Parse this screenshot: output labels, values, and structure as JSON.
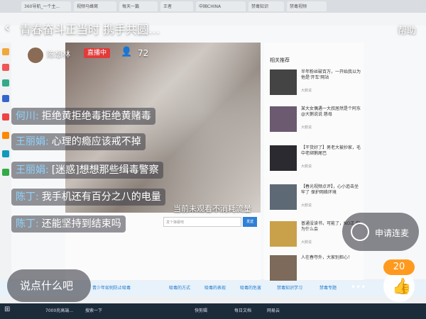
{
  "browser": {
    "tabs": [
      "360导航_一个主...",
      "视频马蜂窝",
      "每天一篇",
      "王者",
      "中国CHINA",
      "禁毒知识",
      "禁毒视频"
    ],
    "bottom_tabs": [
      "青少年如何防止吸毒",
      "吸毒的方式",
      "吸毒的表现",
      "吸毒的危害",
      "禁毒知识学习",
      "禁毒专题"
    ],
    "input_placeholder": "发个弹幕吧",
    "send_label": "发送"
  },
  "live": {
    "title": "青春奋斗正当时 携手共圆…",
    "help_label": "帮助",
    "host_name": "陈想林",
    "live_badge": "直播中",
    "viewer_count": "72",
    "watching_notice": "当前未观看不消耗流量",
    "comments": [
      {
        "user": "何川:",
        "text": "拒绝黄拒绝毒拒绝黄赌毒"
      },
      {
        "user": "王丽娟:",
        "text": "心理的瘾应该戒不掉"
      },
      {
        "user": "王丽娟:",
        "text": "[迷惑]想想那些缉毒警察"
      },
      {
        "user": "陈丁:",
        "text": "我手机还有百分之八的电量"
      },
      {
        "user": "陈丁:",
        "text": "还能坚持到结束吗"
      }
    ],
    "say_placeholder": "说点什么吧",
    "mic_request_label": "申请连麦",
    "like_count": "20"
  },
  "recommend": {
    "header": "相关推荐",
    "items": [
      {
        "title": "半年粉丝破百万，一开始我以为他是'开车'网站",
        "meta": "大鹅说"
      },
      {
        "title": "某大女偶遇一大叔居然是个阿东 @大鹅说说 慈母",
        "meta": "大鹅说"
      },
      {
        "title": "【干货好了】男老大被抄家，毛中老绑鹅尾巴",
        "meta": "大鹅说"
      },
      {
        "title": "【春光视频点评】，心小追击坐牢了 保护网络环境",
        "meta": "大鹅说"
      },
      {
        "title": "普通没读书，可能了，NO正 你为什么会",
        "meta": "大鹅说"
      },
      {
        "title": "人在春夺外，大家别担心！",
        "meta": "大鹅说"
      }
    ]
  },
  "taskbar": {
    "items": [
      "7000兆高端...",
      "搜索一下",
      "快剪辑",
      "每日文档",
      "网易云"
    ]
  },
  "colors": {
    "live_red": "#e23b3b",
    "like_orange": "#ff9a1f",
    "user_blue": "#8fd3ff"
  }
}
